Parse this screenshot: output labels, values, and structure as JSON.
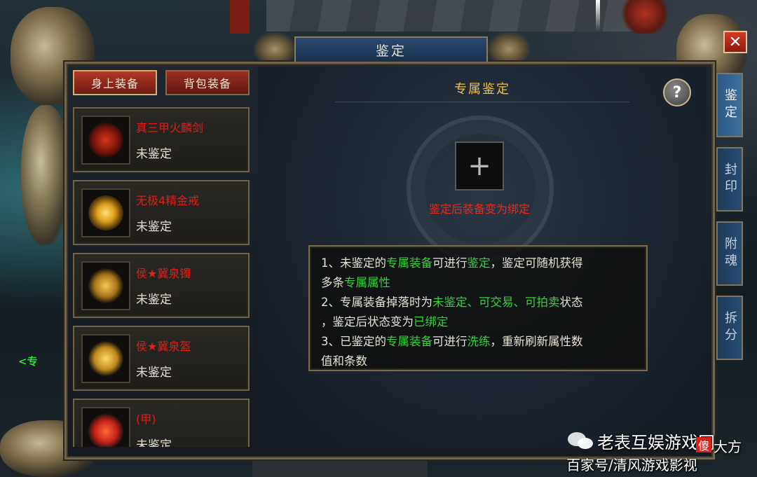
{
  "window": {
    "title": "鉴定",
    "close_label": "✕"
  },
  "left_tabs": [
    {
      "label": "身上装备",
      "active": true
    },
    {
      "label": "背包装备",
      "active": false
    }
  ],
  "items": [
    {
      "name": "真三甲火麟剑",
      "status": "未鉴定",
      "icon": "sword-icon",
      "color": "#c3211a"
    },
    {
      "name": "无极4精金戒",
      "status": "未鉴定",
      "icon": "ring-icon",
      "color": "#e0a01c"
    },
    {
      "name": "侯★冀泉镯",
      "status": "未鉴定",
      "icon": "bracelet-icon",
      "color": "#d09a20"
    },
    {
      "name": "侯★冀泉盔",
      "status": "未鉴定",
      "icon": "helmet-icon",
      "color": "#d8a828"
    },
    {
      "name": "(甲)",
      "status": "未鉴定",
      "icon": "armor-icon",
      "color": "#d8341c"
    }
  ],
  "main": {
    "section_title": "专属鉴定",
    "help_label": "?",
    "slot_label": "+",
    "bind_note": "鉴定后装备变为绑定",
    "info": {
      "line1_a": "1、未鉴定的",
      "line1_b": "专属装备",
      "line1_c": "可进行",
      "line1_d": "鉴定",
      "line1_e": "，鉴定可随机获得",
      "line2_a": "多条",
      "line2_b": "专属属性",
      "line3_a": "2、专属装备掉落时为",
      "line3_b": "未鉴定、可交易、可拍卖",
      "line3_c": "状态",
      "line4_a": "，鉴定后状态变为",
      "line4_b": "已绑定",
      "line5_a": "3、已鉴定的",
      "line5_b": "专属装备",
      "line5_c": "可进行",
      "line5_d": "洗练",
      "line5_e": "，重新刷新属性数",
      "line6": "值和条数"
    }
  },
  "side_tabs": [
    {
      "label": "鉴定",
      "active": true
    },
    {
      "label": "封印",
      "active": false
    },
    {
      "label": "附魂",
      "active": false
    },
    {
      "label": "拆分",
      "active": false
    }
  ],
  "watermark": {
    "line1": "老表互娱游戏网",
    "badge": "傻",
    "line1_tail": "大方",
    "line2": "百家号/清风游戏影视"
  },
  "arrow_label": "<专",
  "colors": {
    "accent_green": "#36d13a",
    "accent_red": "#e62a1c",
    "gold": "#f2c23a"
  }
}
